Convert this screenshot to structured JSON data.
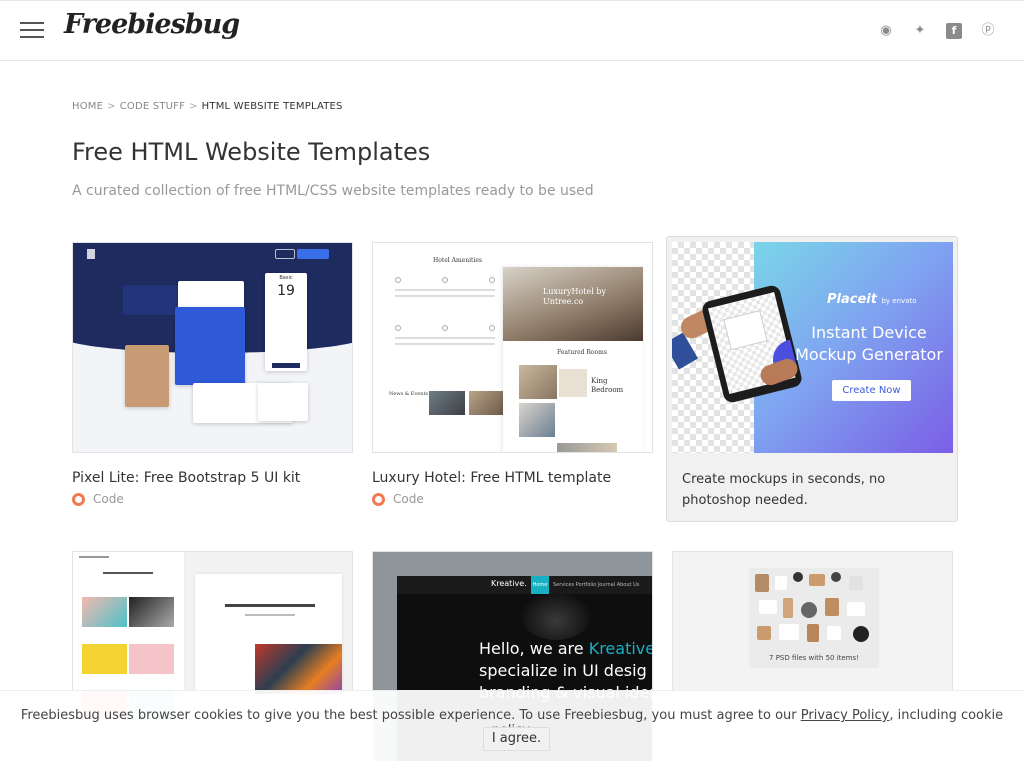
{
  "header": {
    "logo_text": "Freebiesbug",
    "social": [
      {
        "name": "rss-icon",
        "glyph": "◉"
      },
      {
        "name": "twitter-icon",
        "glyph": "✦"
      },
      {
        "name": "facebook-icon",
        "glyph": "f"
      },
      {
        "name": "pinterest-icon",
        "glyph": "ⓟ"
      }
    ]
  },
  "breadcrumb": {
    "home": "HOME",
    "sep1": ">",
    "code": "CODE STUFF",
    "sep2": ">",
    "current": "HTML WEBSITE TEMPLATES"
  },
  "page": {
    "title": "Free HTML Website Templates",
    "subtitle": "A curated collection of free HTML/CSS website templates ready to be used"
  },
  "cards": [
    {
      "title": "Pixel Lite: Free Bootstrap 5 UI kit",
      "category": "Code",
      "thumb_price": "19",
      "thumb_plan": "Basic"
    },
    {
      "title": "Luxury Hotel: Free HTML template",
      "category": "Code",
      "thumb_heading": "Hotel Amenities",
      "thumb_hero": "LuxuryHotel by Untree.co",
      "thumb_featured": "Featured Rooms",
      "thumb_room": "King Bedroom",
      "thumb_news": "News & Events"
    }
  ],
  "ad": {
    "brand": "Placeit",
    "brand_by": "by envato",
    "headline": "Instant Device Mockup Generator",
    "button": "Create Now",
    "text": "Create mockups in seconds, no photoshop needed."
  },
  "row2": {
    "kreative_brand": "Kreative.",
    "kreative_home": "Home",
    "kreative_nav": "Services   Portfolio   Journal   About Us",
    "kreative_hello_a": "Hello, we are ",
    "kreative_hello_b": "Kreative.",
    "kreative_line2": "specialize in UI desig",
    "kreative_line3": "branding & visual iden",
    "mock_caption": "7 PSD files with 50 items!"
  },
  "cookie": {
    "text_a": "Freebiesbug uses browser cookies to give you the best possible experience. To use Freebiesbug, you must agree to our ",
    "link": "Privacy Policy",
    "text_b": ", including cookie policy.",
    "button": "I agree."
  },
  "colors": {
    "accent": "#f07a52",
    "placeit_gradient": [
      "#7ad6e8",
      "#7b5ee6"
    ],
    "kreative_accent": "#1ab0c4"
  }
}
